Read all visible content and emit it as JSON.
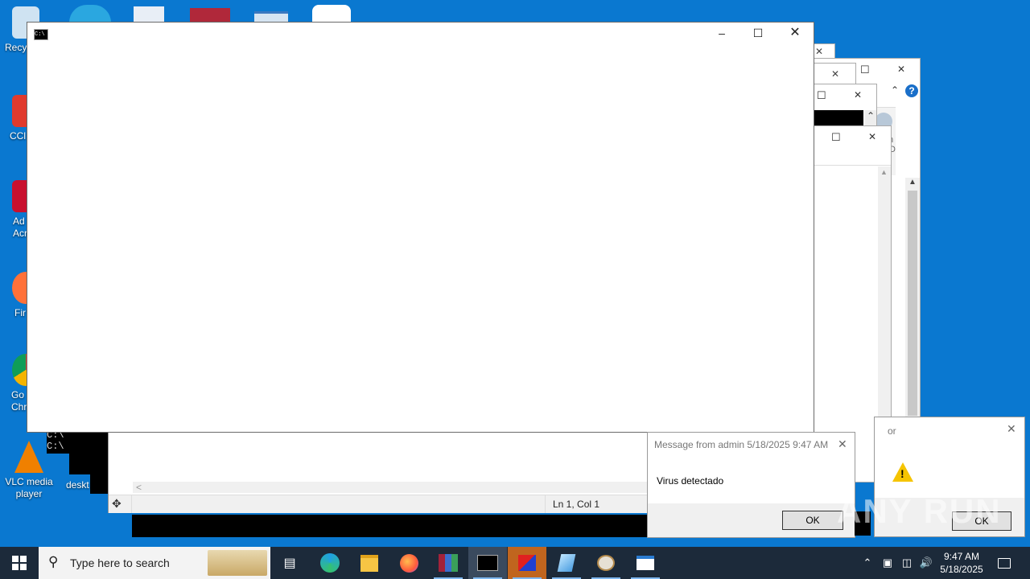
{
  "desktop": {
    "icons": [
      {
        "label": "Recy",
        "icon": "recycle-bin-icon"
      },
      {
        "label": "CCl",
        "icon": "ccleaner-icon"
      },
      {
        "label": "Ad\nAcr",
        "icon": "adobe-acrobat-icon"
      },
      {
        "label": "Fir",
        "icon": "firefox-icon"
      },
      {
        "label": "Go\nChr",
        "icon": "chrome-icon"
      },
      {
        "label": "VLC media\nplayer",
        "icon": "vlc-icon"
      },
      {
        "label": "deskt",
        "icon": "file-icon"
      }
    ],
    "cmd_snippet_line1": "C:\\",
    "cmd_snippet_line2": "C:\\"
  },
  "main_window": {
    "title_icon": "cmd-icon",
    "minimize": "–",
    "maximize": "☐",
    "close": "✕"
  },
  "notepad": {
    "status_position": "Ln 1, Col 1",
    "scroll_left": "<",
    "scroll_right": ">"
  },
  "msg_dialog": {
    "title": "Message from admin 5/18/2025 9:47 AM",
    "body": "Virus detectado",
    "ok": "OK",
    "close": "✕"
  },
  "error_dialog": {
    "title_fragment": "or",
    "ok": "OK",
    "close": "✕"
  },
  "bg_windows": {
    "close": "✕",
    "maximize": "☐",
    "help": "?",
    "partial_text_1": "th",
    "partial_text_2": "D"
  },
  "taskbar": {
    "search_placeholder": "Type here to search",
    "time": "9:47 AM",
    "date": "5/18/2025",
    "apps": [
      "task-view-icon",
      "edge-icon",
      "file-explorer-icon",
      "firefox-icon",
      "winrar-icon",
      "cmd-icon",
      "app-icon",
      "notes-icon",
      "paint-icon",
      "text-editor-icon"
    ]
  },
  "watermark": "ANY RUN"
}
